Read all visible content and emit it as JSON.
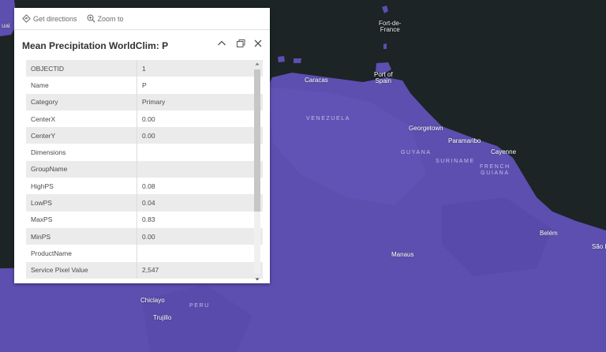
{
  "popup": {
    "actions": {
      "directions": "Get directions",
      "zoom": "Zoom to"
    },
    "title": "Mean Precipitation WorldClim: P",
    "attributes": [
      {
        "key": "OBJECTID",
        "value": "1"
      },
      {
        "key": "Name",
        "value": "P"
      },
      {
        "key": "Category",
        "value": "Primary"
      },
      {
        "key": "CenterX",
        "value": "0.00"
      },
      {
        "key": "CenterY",
        "value": "0.00"
      },
      {
        "key": "Dimensions",
        "value": ""
      },
      {
        "key": "GroupName",
        "value": ""
      },
      {
        "key": "HighPS",
        "value": "0.08"
      },
      {
        "key": "LowPS",
        "value": "0.04"
      },
      {
        "key": "MaxPS",
        "value": "0.83"
      },
      {
        "key": "MinPS",
        "value": "0.00"
      },
      {
        "key": "ProductName",
        "value": ""
      },
      {
        "key": "Service Pixel Value",
        "value": "2,547"
      }
    ]
  },
  "map": {
    "cities": {
      "fortdefrance": "Fort-de-\nFrance",
      "caracas": "Caracas",
      "portofspain": "Port of\nSpain",
      "georgetown": "Georgetown",
      "paramaribo": "Paramaribo",
      "cayenne": "Cayenne",
      "belem": "Belém",
      "saoluis": "São L",
      "manaus": "Manaus",
      "chiclayo": "Chiclayo",
      "trujillo": "Trujillo",
      "edge": "uai"
    },
    "countries": {
      "venezuela": "VENEZUELA",
      "guyana": "GUYANA",
      "suriname": "SURINAME",
      "frenchguiana": "FRENCH\nGUIANA",
      "peru": "PERU"
    },
    "colors": {
      "water": "#1c2426",
      "land": "#5c4fb0"
    }
  }
}
